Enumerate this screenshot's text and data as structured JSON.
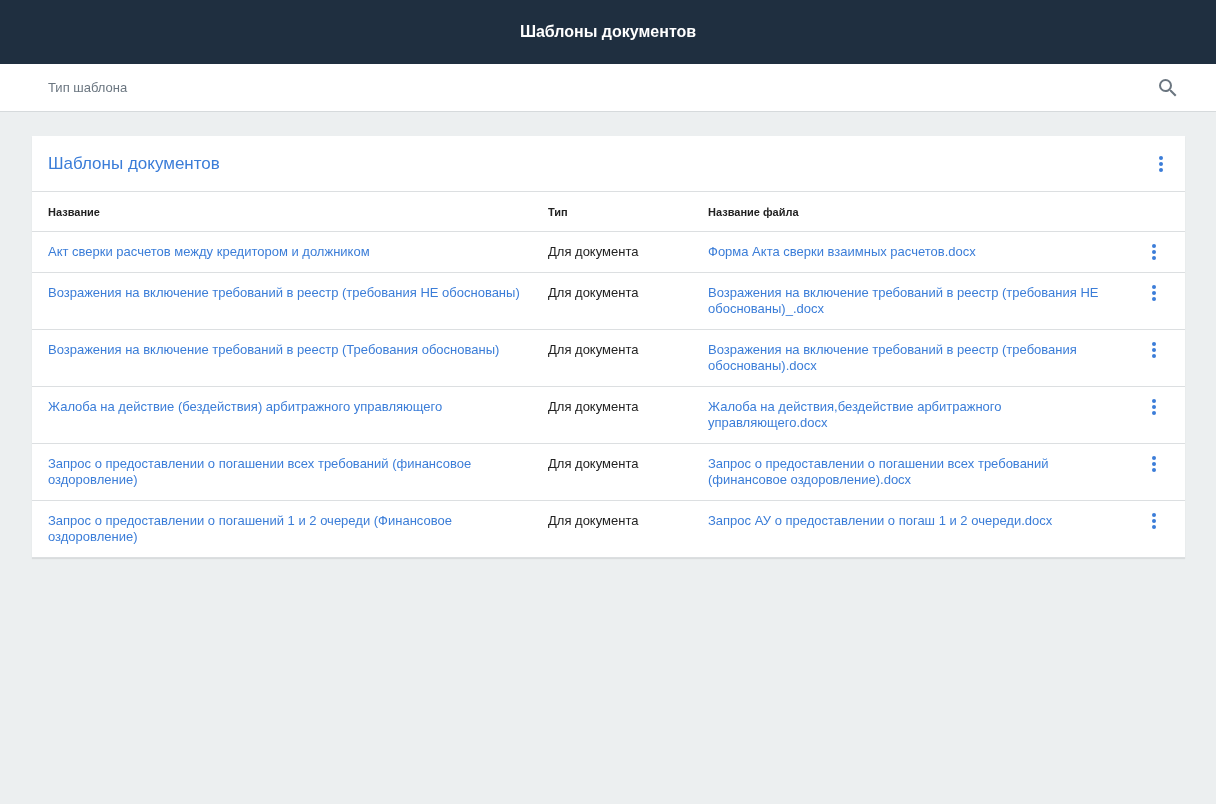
{
  "header": {
    "title": "Шаблоны документов"
  },
  "search": {
    "placeholder": "Тип шаблона"
  },
  "card": {
    "title": "Шаблоны документов",
    "table": {
      "columns": [
        "Название",
        "Тип",
        "Название файла"
      ],
      "rows": [
        {
          "name": "Акт сверки расчетов между кредитором и должником",
          "type": "Для документа",
          "file": "Форма Акта сверки взаимных расчетов.docx"
        },
        {
          "name": "Возражения на включение требований в реестр (требования НЕ обоснованы)",
          "type": "Для документа",
          "file": "Возражения на включение требований в реестр (требования НЕ обоснованы)_.docx"
        },
        {
          "name": "Возражения на включение требований в реестр (Требования обоснованы)",
          "type": "Для документа",
          "file": "Возражения на включение требований в реестр (требования обоснованы).docx"
        },
        {
          "name": "Жалоба на действие (бездействия) арбитражного управляющего",
          "type": "Для документа",
          "file": "Жалоба на действия,бездействие арбитражного управляющего.docx"
        },
        {
          "name": "Запрос о предоставлении о погашении всех требований (финансовое оздоровление)",
          "type": "Для документа",
          "file": "Запрос о предоставлении о погашении всех требований (финансовое оздоровление).docx"
        },
        {
          "name": "Запрос о предоставлении о погашений 1 и 2 очереди (Финансовое оздоровление)",
          "type": "Для документа",
          "file": "Запрос АУ о предоставлении о погаш 1 и 2 очереди.docx"
        }
      ]
    }
  }
}
